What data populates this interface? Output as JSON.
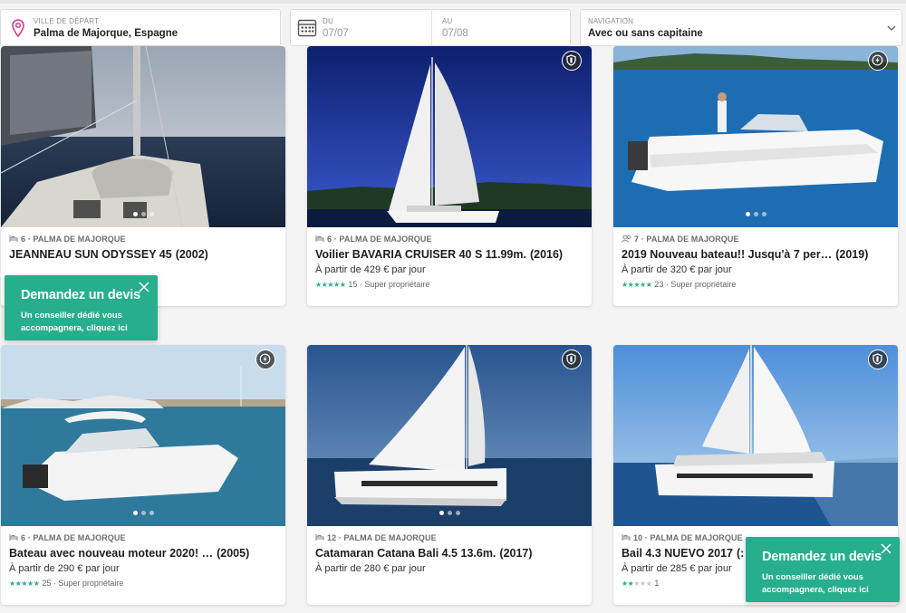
{
  "search": {
    "departure": {
      "label": "VILLE DE DÉPART",
      "value": "Palma de Majorque, Espagne",
      "icon": "map-pin-icon"
    },
    "from": {
      "label": "DU",
      "placeholder": "07/07",
      "icon": "calendar-icon"
    },
    "to": {
      "label": "AU",
      "placeholder": "07/08"
    },
    "navigation": {
      "label": "NAVIGATION",
      "value": "Avec ou sans capitaine",
      "icon": "chevron-down-icon"
    }
  },
  "colors": {
    "accent": "#27ae8c",
    "text": "#1d1d1d",
    "muted": "#6d6d6d"
  },
  "listings": [
    {
      "meta": "6 · PALMA DE MAJORQUE",
      "meta_icon": "bed-icon",
      "title": "JEANNEAU SUN ODYSSEY 45",
      "year": "(2002)",
      "price": "",
      "stars": 0,
      "reviews": "",
      "owner": "",
      "badge": "",
      "dots": 3,
      "active_dot": 0
    },
    {
      "meta": "6 · PALMA DE MAJORQUE",
      "meta_icon": "bed-icon",
      "title": "Voilier BAVARIA CRUISER 40 S 11.99m.",
      "year": "(2016)",
      "price": "À partir de 429 € par jour",
      "stars": 5,
      "reviews": "15",
      "owner": "· Super propriétaire",
      "badge": "shield-icon",
      "dots": 0,
      "active_dot": 0
    },
    {
      "meta": "7 · PALMA DE MAJORQUE",
      "meta_icon": "people-icon",
      "title": "2019 Nouveau bateau!! Jusqu'à 7 per…",
      "year": "(2019)",
      "price": "À partir de 320 € par jour",
      "stars": 5,
      "reviews": "23",
      "owner": "· Super propriétaire",
      "badge": "lightning-icon",
      "dots": 3,
      "active_dot": 0
    },
    {
      "meta": "6 · PALMA DE MAJORQUE",
      "meta_icon": "bed-icon",
      "title": "Bateau avec nouveau moteur 2020! …",
      "year": "(2005)",
      "price": "À partir de 290 € par jour",
      "stars": 5,
      "reviews": "25",
      "owner": "· Super propriétaire",
      "badge": "lightning-icon",
      "dots": 3,
      "active_dot": 0
    },
    {
      "meta": "12 · PALMA DE MAJORQUE",
      "meta_icon": "bed-icon",
      "title": "Catamaran Catana Bali 4.5 13.6m.",
      "year": "(2017)",
      "price": "À partir de 280 € par jour",
      "stars": 0,
      "reviews": "",
      "owner": "",
      "badge": "shield-icon",
      "dots": 3,
      "active_dot": 0
    },
    {
      "meta": "10 · PALMA DE MAJORQUE",
      "meta_icon": "bed-icon",
      "title": "Bail 4.3 NUEVO 2017",
      "year": "(:",
      "price": "À partir de 285 € par jour",
      "stars": 2,
      "reviews": "1",
      "owner": "",
      "badge": "shield-icon",
      "dots": 0,
      "active_dot": 0
    }
  ],
  "devis": {
    "title": "Demandez un devis",
    "subtitle": "Un conseiller dédié vous accompagnera, cliquez ici",
    "close_icon": "close-icon"
  }
}
